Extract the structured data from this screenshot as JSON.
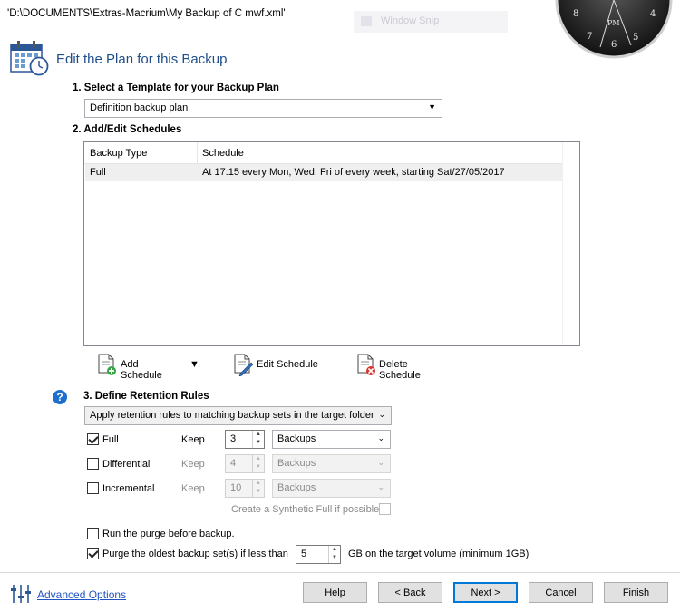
{
  "window": {
    "title": "'D:\\DOCUMENTS\\Extras-Macrium\\My Backup of C mwf.xml'",
    "ghost_label": "Window Snip"
  },
  "clock": {
    "numbers": [
      "8",
      "4",
      "7",
      "6",
      "5"
    ],
    "period": "PM"
  },
  "header": {
    "title": "Edit the Plan for this Backup",
    "icon": "calendar-clock-icon"
  },
  "template_section": {
    "heading": "1. Select a Template for your Backup Plan",
    "selected": "Definition backup plan"
  },
  "schedules_section": {
    "heading": "2. Add/Edit Schedules",
    "columns": [
      "Backup Type",
      "Schedule"
    ],
    "rows": [
      {
        "type": "Full",
        "schedule": "At 17:15 every Mon, Wed, Fri of every week, starting Sat/27/05/2017"
      }
    ],
    "toolbar": {
      "add": "Add Schedule",
      "edit": "Edit Schedule",
      "delete": "Delete Schedule"
    }
  },
  "retention_section": {
    "heading": "3. Define Retention Rules",
    "rule_mode": "Apply retention rules to matching backup sets in the target folder",
    "keep_label": "Keep",
    "rules": [
      {
        "label": "Full",
        "checked": true,
        "enabled": true,
        "keep": "3",
        "unit": "Backups"
      },
      {
        "label": "Differential",
        "checked": false,
        "enabled": false,
        "keep": "4",
        "unit": "Backups"
      },
      {
        "label": "Incremental",
        "checked": false,
        "enabled": false,
        "keep": "10",
        "unit": "Backups"
      }
    ],
    "synthetic_full": "Create a Synthetic Full if possible"
  },
  "purge": {
    "run_before": "Run the purge before backup.",
    "oldest_label": "Purge the oldest backup set(s) if less than",
    "gb_value": "5",
    "gb_suffix": "GB on the target volume (minimum 1GB)"
  },
  "footer": {
    "advanced_options": "Advanced Options",
    "help": "Help",
    "back": "< Back",
    "next": "Next >",
    "cancel": "Cancel",
    "finish": "Finish"
  }
}
